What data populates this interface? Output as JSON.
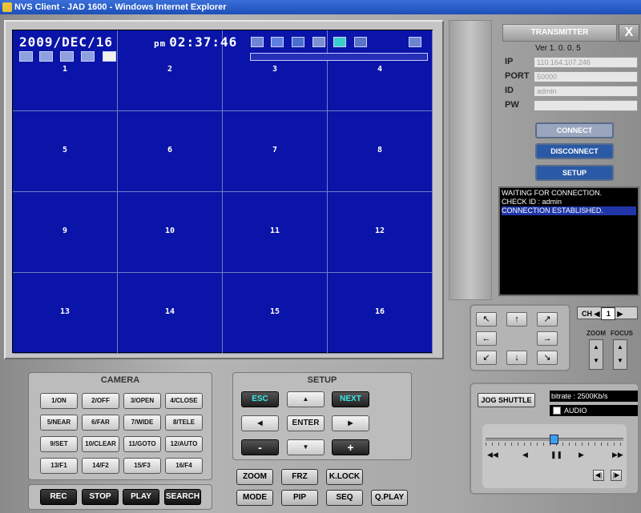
{
  "window": {
    "title": "NVS Client - JAD 1600 - Windows Internet Explorer"
  },
  "osd": {
    "date": "2009/DEC/16",
    "ampm": "pm",
    "time": "02:37:46"
  },
  "grid": {
    "cells": [
      "1",
      "2",
      "3",
      "4",
      "5",
      "6",
      "7",
      "8",
      "9",
      "10",
      "11",
      "12",
      "13",
      "14",
      "15",
      "16"
    ]
  },
  "transmitter": {
    "title": "TRANSMITTER",
    "close": "X",
    "version": "Ver 1. 0. 0. 5",
    "ip_label": "IP",
    "ip_value": "110.164.107.246",
    "port_label": "PORT",
    "port_value": "50000",
    "id_label": "ID",
    "id_value": "admin",
    "pw_label": "PW",
    "pw_value": "",
    "connect": "CONNECT",
    "disconnect": "DISCONNECT",
    "setup": "SETUP"
  },
  "log": {
    "lines": [
      "WAITING FOR CONNECTION.",
      "CHECK ID : admin",
      "CONNECTION ESTABLISHED."
    ]
  },
  "ptz": {
    "ch_label": "CH",
    "ch_value": "1",
    "zoom": "ZOOM",
    "focus": "FOCUS"
  },
  "jog": {
    "label": "JOG SHUTTLE",
    "bitrate": "bitrate : 2500Kb/s",
    "audio": "AUDIO"
  },
  "camera": {
    "title": "CAMERA",
    "buttons": [
      "1/ON",
      "2/OFF",
      "3/OPEN",
      "4/CLOSE",
      "5/NEAR",
      "6/FAR",
      "7/WIDE",
      "8/TELE",
      "9/SET",
      "10/CLEAR",
      "11/GOTO",
      "12/AUTO",
      "13/F1",
      "14/F2",
      "15/F3",
      "16/F4"
    ]
  },
  "setup": {
    "title": "SETUP",
    "esc": "ESC",
    "next": "NEXT",
    "enter": "ENTER",
    "minus": "-",
    "plus": "+"
  },
  "bottom": {
    "rec": "REC",
    "stop": "STOP",
    "play": "PLAY",
    "search": "SEARCH",
    "zoom": "ZOOM",
    "frz": "FRZ",
    "klock": "K.LOCK",
    "mode": "MODE",
    "pip": "PIP",
    "seq": "SEQ",
    "qplay": "Q.PLAY"
  },
  "colors": {
    "video_bg": "#0a14a8",
    "connect_btn": "#9aa6bd",
    "active_btn": "#2a5aa6",
    "esc_next_text": "#3de8e8"
  }
}
